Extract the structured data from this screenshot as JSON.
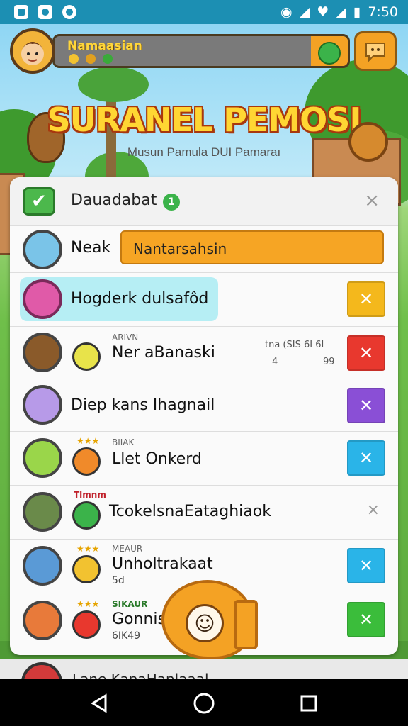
{
  "status_bar": {
    "time": "7:50",
    "icons": [
      "app-icon",
      "media-icon",
      "puzzle-icon",
      "sync-icon",
      "mute-icon",
      "wifi-icon",
      "signal-icon",
      "battery-icon"
    ]
  },
  "hud": {
    "player_name": "Namaasian",
    "gem_colors": [
      "#f2c230",
      "#e0a020",
      "#3aaa3a"
    ]
  },
  "title": {
    "main": "SURANEL PEMOSI",
    "sub": "Musun Pamula DUI Pamaraı"
  },
  "panel": {
    "header": {
      "title": "Dauadabat",
      "badge": "1",
      "close_label": "×"
    },
    "rows": [
      {
        "label": "Neak",
        "field_value": "Nantarsahsin"
      },
      {
        "label": "Hogderk dulsafôd",
        "action_color": "#f4b81c",
        "action_icon": "cross-arrows-icon"
      },
      {
        "small": "ARIVN",
        "label": "Ner aBanaski",
        "stat1": "tna (SIS 6I 6I",
        "stat2": "4",
        "stat3": "99",
        "action_color": "#e8382e",
        "action_icon": "cross-arrows-icon"
      },
      {
        "label": "Diep kans Ihagnail",
        "action_color": "#8a4fd6",
        "action_icon": "cross-arrows-icon"
      },
      {
        "small": "BIIAK",
        "label": "Llet Onkerd",
        "action_color": "#2ab4e8",
        "action_icon": "cross-arrows-icon"
      },
      {
        "tag": "Tlmnm",
        "label": "TcokelsnaEataghiaok",
        "action_icon": "close-icon"
      },
      {
        "small": "MEAUR",
        "label": "Unholtrakaat",
        "sub": "5d",
        "action_color": "#2ab4e8",
        "action_icon": "link-icon"
      },
      {
        "small": "SIKAUR",
        "label": "Gonnis",
        "sub": "6IK49",
        "action_color": "#3bbd3b",
        "action_icon": "cross-arrows-icon"
      }
    ],
    "peek_label": "Lane KanaHanlaaal"
  },
  "nav": {
    "back": "◁",
    "home": "○",
    "recents": "□"
  }
}
